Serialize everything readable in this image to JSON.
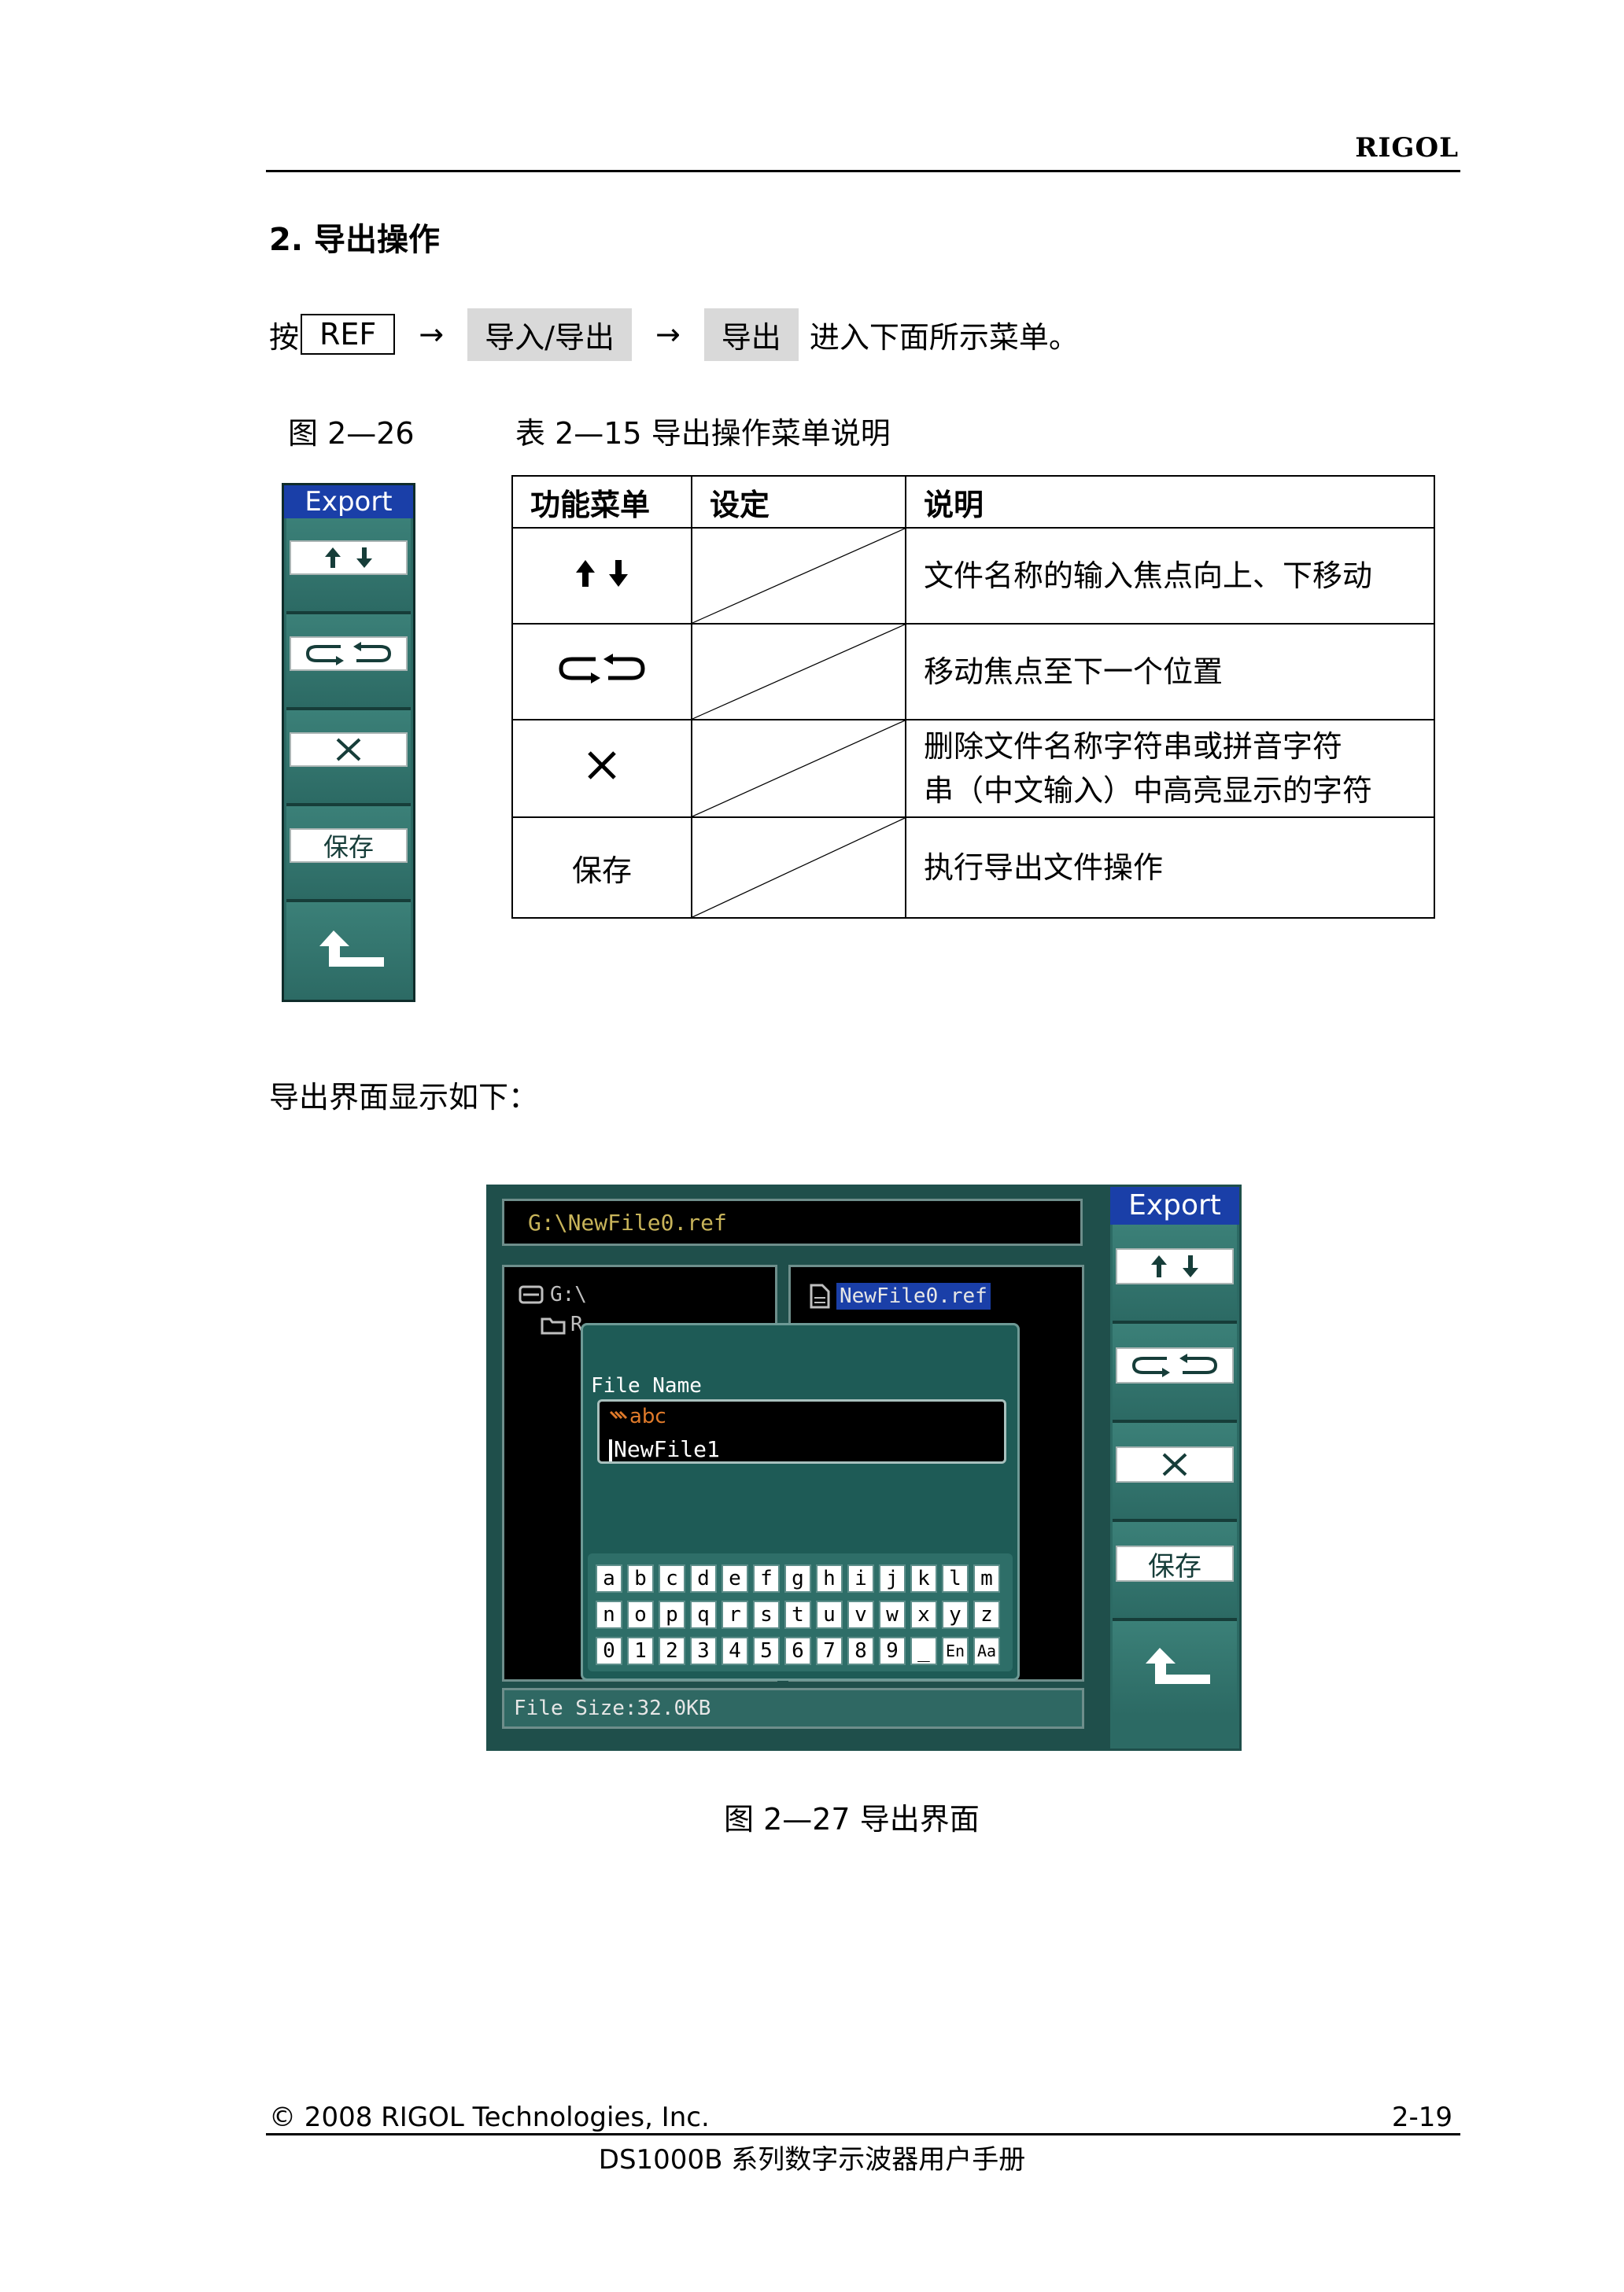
{
  "header": {
    "brand": "RIGOL"
  },
  "section": {
    "title": "2.  导出操作"
  },
  "steps": {
    "prefix": "按",
    "key": "REF",
    "softkey1": "导入/导出",
    "softkey2": "导出",
    "suffix": "进入下面所示菜单。",
    "arrow": "→"
  },
  "captions": {
    "fig26": "图 2—26",
    "table15": "表 2—15  导出操作菜单说明",
    "subtitle": "导出界面显示如下：",
    "fig27": "图 2—27  导出界面"
  },
  "menu_panel": {
    "title": "Export",
    "save_label": "保存",
    "icons": [
      "up-down-arrows-icon",
      "cycle-arrows-icon",
      "delete-x-icon",
      "save-button",
      "return-arrow-icon"
    ]
  },
  "table": {
    "headers": [
      "功能菜单",
      "设定",
      "说明"
    ],
    "rows": [
      {
        "menu": "",
        "icon": "up-down-arrows-icon",
        "desc_lines": [
          "文件名称的输入焦点向上、下移动"
        ]
      },
      {
        "menu": "",
        "icon": "cycle-arrows-icon",
        "desc_lines": [
          "移动焦点至下一个位置"
        ]
      },
      {
        "menu": "",
        "icon": "delete-x-icon",
        "desc_lines": [
          "删除文件名称字符串或拼音字符",
          "串（中文输入）中高亮显示的字符"
        ]
      },
      {
        "menu": "保存",
        "icon": "",
        "desc_lines": [
          "执行导出文件操作"
        ]
      }
    ]
  },
  "screen": {
    "path": "G:\\NewFile0.ref",
    "tree_root": "G:\\",
    "tree_child": "R...",
    "selected_file": "NewFile0.ref",
    "dialog": {
      "label": "File Name",
      "input_mode": "abc",
      "value": "NewFile1"
    },
    "keyboard_rows": [
      [
        "a",
        "b",
        "c",
        "d",
        "e",
        "f",
        "g",
        "h",
        "i",
        "j",
        "k",
        "l",
        "m"
      ],
      [
        "n",
        "o",
        "p",
        "q",
        "r",
        "s",
        "t",
        "u",
        "v",
        "w",
        "x",
        "y",
        "z"
      ],
      [
        "0",
        "1",
        "2",
        "3",
        "4",
        "5",
        "6",
        "7",
        "8",
        "9",
        "_",
        "En",
        "Aa"
      ]
    ],
    "status": "File Size:32.0KB",
    "menu": {
      "title": "Export",
      "save_label": "保存"
    }
  },
  "footer": {
    "copyright": "© 2008 RIGOL Technologies, Inc.",
    "page": "2-19",
    "manual": "DS1000B 系列数字示波器用户手册"
  },
  "colors": {
    "panel_teal": "#2c6a64",
    "menu_title_blue": "#1a3fa8",
    "path_text": "#c8b45a",
    "highlight_blue": "#1a3fa8",
    "abc_orange": "#e07a2a"
  }
}
